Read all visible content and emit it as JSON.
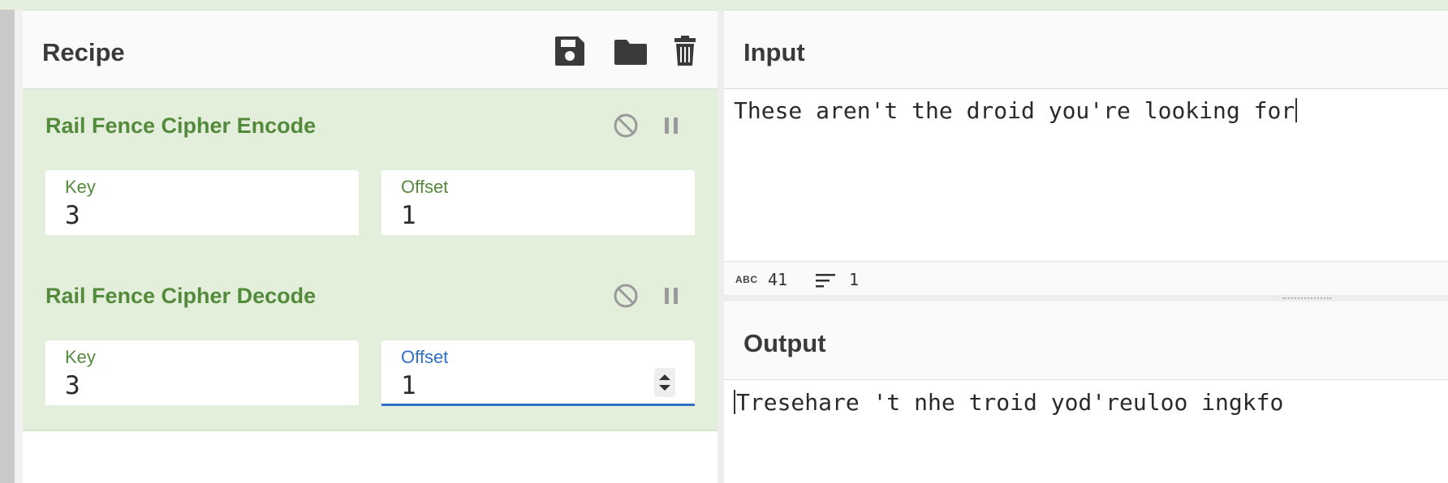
{
  "recipe": {
    "title": "Recipe",
    "icons": [
      "save-icon",
      "folder-icon",
      "trash-icon"
    ]
  },
  "operations": [
    {
      "name": "Rail Fence Cipher Encode",
      "key_label": "Key",
      "key_value": "3",
      "offset_label": "Offset",
      "offset_value": "1"
    },
    {
      "name": "Rail Fence Cipher Decode",
      "key_label": "Key",
      "key_value": "3",
      "offset_label": "Offset",
      "offset_value": "1"
    }
  ],
  "input": {
    "title": "Input",
    "text": "These aren't the droid you're looking for",
    "stats": {
      "abc_label": "ABC",
      "length": "41",
      "lines": "1"
    }
  },
  "output": {
    "title": "Output",
    "text": "Tresehare 't nhe troid yod'reuloo ingkfo"
  },
  "colors": {
    "operation_bg": "#e3efda",
    "operation_title": "#548a3b",
    "focus_accent": "#2f6fc8"
  }
}
